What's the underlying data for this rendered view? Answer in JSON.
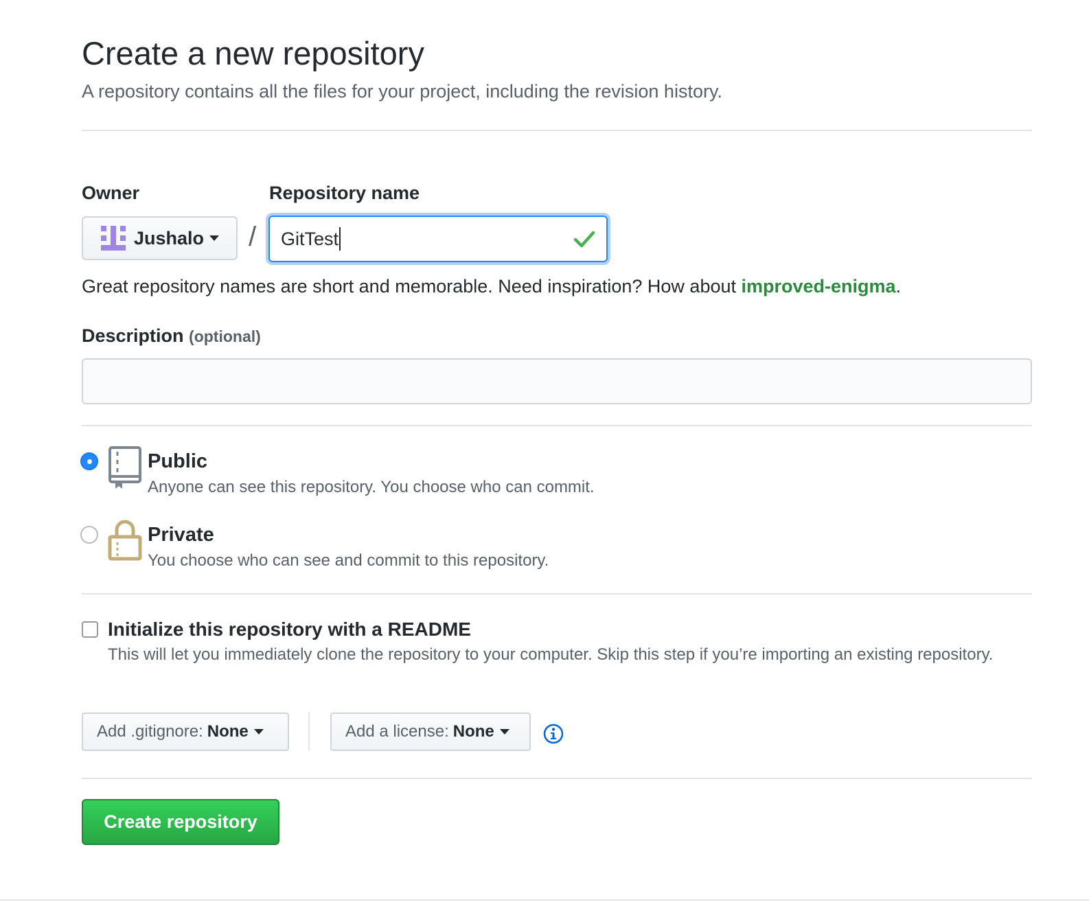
{
  "header": {
    "title": "Create a new repository",
    "subtitle": "A repository contains all the files for your project, including the revision history."
  },
  "owner": {
    "label": "Owner",
    "value": "Jushalo",
    "avatar_color": "#9f84e8"
  },
  "separator": "/",
  "repo_name": {
    "label": "Repository name",
    "value": "GitTest",
    "valid_icon": "check-icon",
    "valid_color": "#4caf50"
  },
  "hint": {
    "prefix": "Great repository names are short and memorable. Need inspiration? How about ",
    "suggestion": "improved-enigma",
    "suffix": "."
  },
  "description": {
    "label": "Description",
    "optional": "(optional)",
    "value": ""
  },
  "visibility": {
    "selected": "public",
    "options": [
      {
        "id": "public",
        "title": "Public",
        "desc": "Anyone can see this repository. You choose who can commit.",
        "icon": "repo-icon"
      },
      {
        "id": "private",
        "title": "Private",
        "desc": "You choose who can see and commit to this repository.",
        "icon": "lock-icon"
      }
    ]
  },
  "readme": {
    "checked": false,
    "title": "Initialize this repository with a README",
    "desc": "This will let you immediately clone the repository to your computer. Skip this step if you’re importing an existing repository."
  },
  "gitignore": {
    "label": "Add .gitignore:",
    "value": "None"
  },
  "license": {
    "label": "Add a license:",
    "value": "None"
  },
  "info_icon": "info-icon",
  "submit": {
    "label": "Create repository",
    "color": "#28a745"
  },
  "colors": {
    "accent": "#2188ff",
    "link_green": "#2c8a3f"
  }
}
